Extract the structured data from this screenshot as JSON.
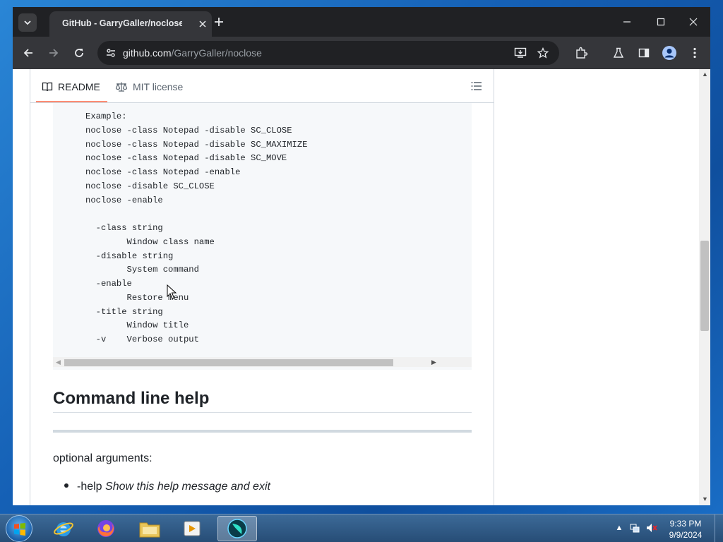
{
  "browser": {
    "tab_title": "GitHub - GarryGaller/noclose: ",
    "url_host": "github.com",
    "url_path": "/GarryGaller/noclose"
  },
  "readme_tabs": {
    "readme": "README",
    "license": "MIT license"
  },
  "code_block": {
    "lines": [
      "Example:",
      "noclose -class Notepad -disable SC_CLOSE",
      "noclose -class Notepad -disable SC_MAXIMIZE",
      "noclose -class Notepad -disable SC_MOVE",
      "noclose -class Notepad -enable",
      "noclose -disable SC_CLOSE",
      "noclose -enable",
      "",
      "  -class string",
      "        Window class name",
      "  -disable string",
      "        System command",
      "  -enable",
      "        Restore menu",
      "  -title string",
      "        Window title",
      "  -v    Verbose output"
    ]
  },
  "section": {
    "heading": "Command line help",
    "optional": "optional arguments:",
    "item_flag": "-help",
    "item_desc": "Show this help message and exit"
  },
  "taskbar": {
    "time": "9:33 PM",
    "date": "9/9/2024",
    "apps": [
      "internet-explorer",
      "firefox",
      "file-explorer",
      "media-player",
      "active-app"
    ]
  },
  "colors": {
    "tab_underline": "#fd8c73",
    "browser_dark": "#202124",
    "toolbar": "#35363a"
  }
}
